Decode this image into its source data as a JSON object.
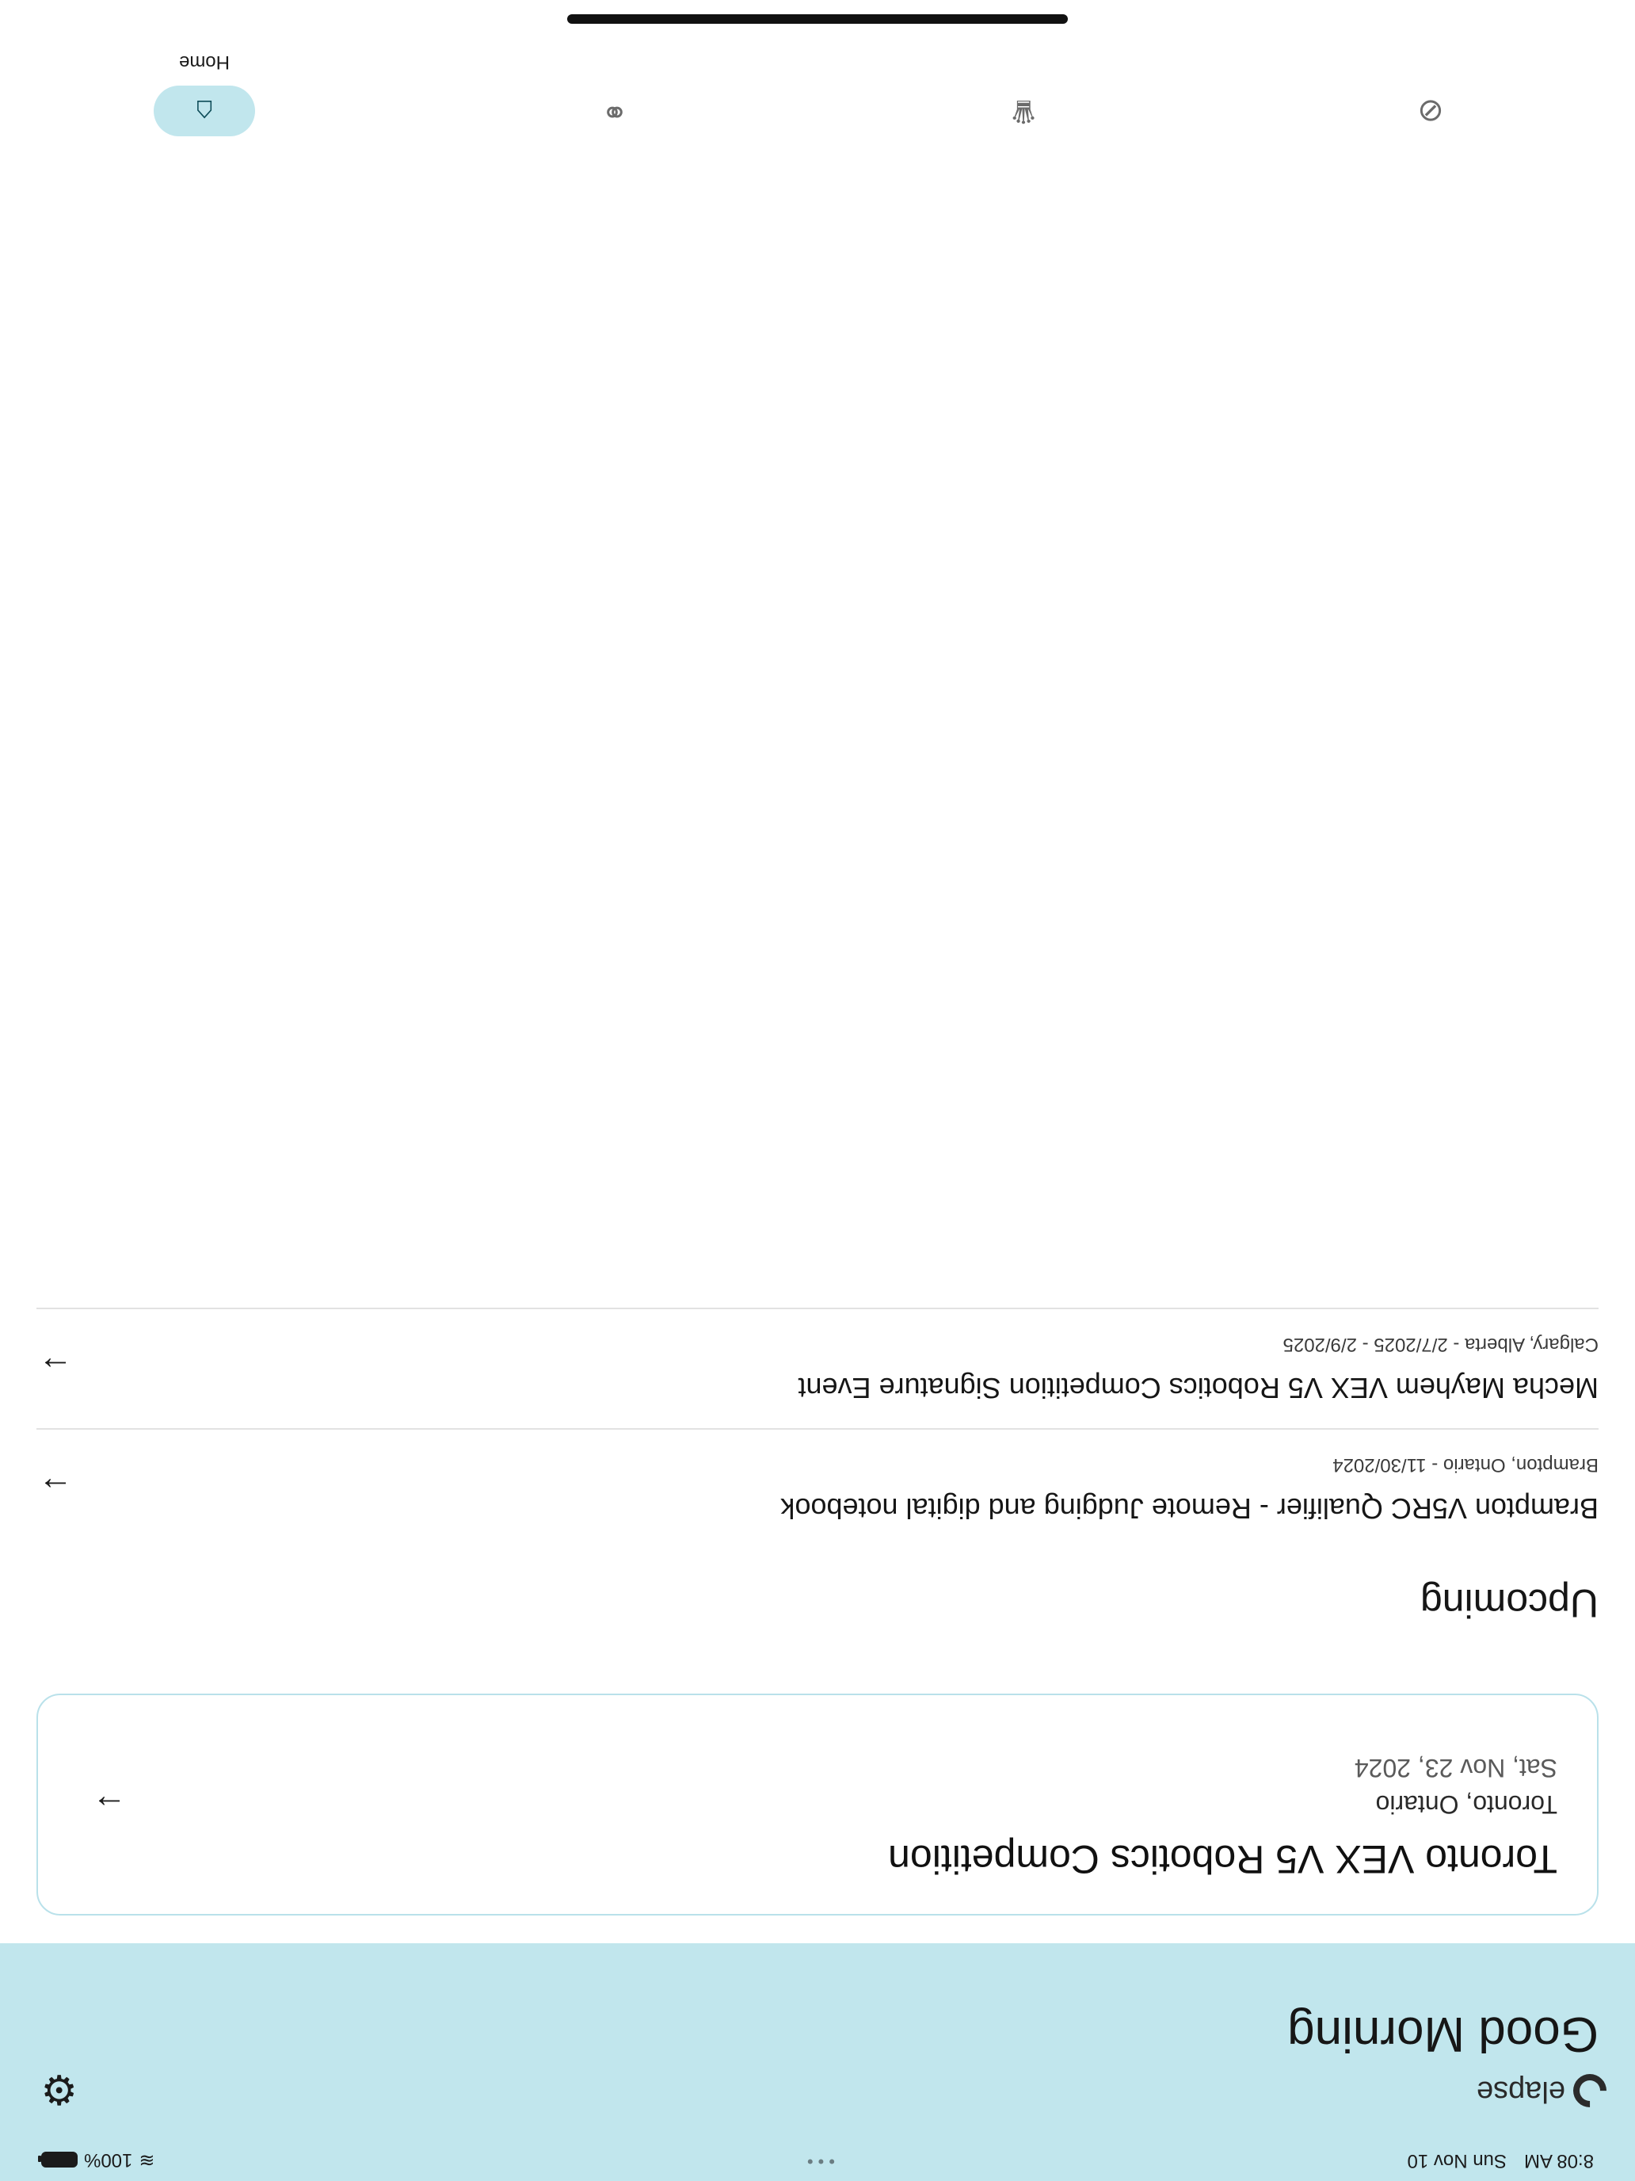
{
  "status_bar": {
    "time": "8:08 AM",
    "date": "Sun Nov 10",
    "battery": "100%",
    "dots": "•••"
  },
  "header": {
    "brand": "elapse",
    "greeting": "Good Morning",
    "background_color": "#c1e6ed"
  },
  "featured_event": {
    "title": "Toronto VEX V5 Robotics Competition",
    "location": "Toronto, Ontario",
    "date": "Sat, Nov 23, 2024"
  },
  "upcoming": {
    "section_title": "Upcoming",
    "events": [
      {
        "title": "Brampton V5RC Qualifier - Remote Judging and digital notebook",
        "meta": "Brampton, Ontario  -  11/30/2024"
      },
      {
        "title": "Mecha Mayhem VEX V5 Robotics Competition Signature Event",
        "meta": "Calgary, Alberta  -  2/7/2025 - 2/9/2025"
      }
    ]
  },
  "bottom_nav": {
    "items": [
      {
        "label": "Home",
        "icon": "home-icon",
        "active": true
      },
      {
        "label": "",
        "icon": "groups-icon",
        "active": false
      },
      {
        "label": "",
        "icon": "trophy-icon",
        "active": false
      },
      {
        "label": "",
        "icon": "compass-icon",
        "active": false
      }
    ]
  },
  "icons": {
    "settings": "⚙",
    "arrow": "→",
    "home": "⌂",
    "groups": "⚭",
    "trophy": "♛",
    "compass": "⊘"
  }
}
